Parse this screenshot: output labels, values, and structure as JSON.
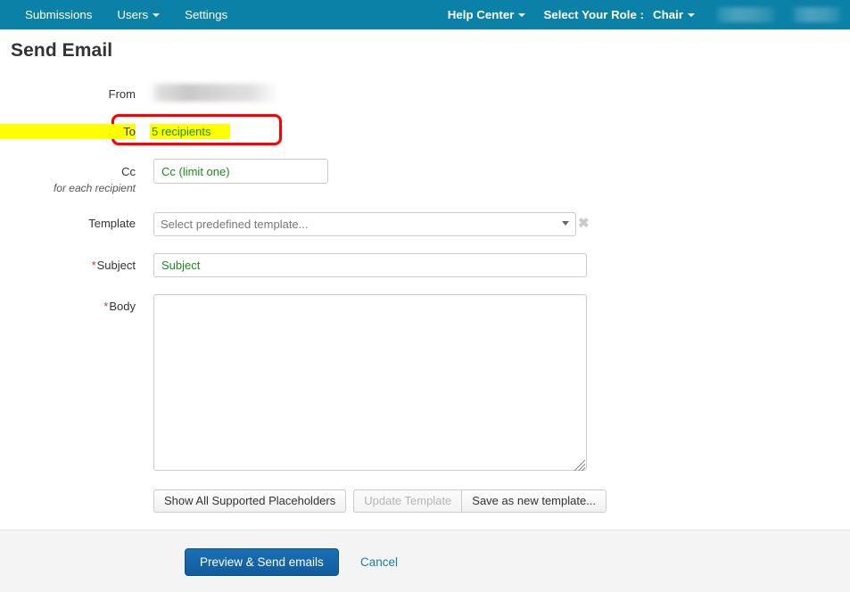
{
  "navbar": {
    "background": "#0b81a7",
    "left_items": [
      {
        "label": "Submissions",
        "has_caret": false
      },
      {
        "label": "Users",
        "has_caret": true
      },
      {
        "label": "Settings",
        "has_caret": false
      }
    ],
    "right_items": [
      {
        "label": "Help Center",
        "has_caret": true
      },
      {
        "label": "Select Your Role :",
        "has_caret": false
      },
      {
        "label": "Chair",
        "has_caret": true
      }
    ],
    "redacted_count": 2
  },
  "page": {
    "title": "Send Email"
  },
  "form": {
    "from": {
      "label": "From",
      "value_redacted": true
    },
    "to": {
      "label": "To",
      "value": "5 recipients",
      "highlight_color": "#ffff00",
      "value_color": "#1d8a1d",
      "annotation_color": "#ff0000"
    },
    "cc": {
      "label": "Cc",
      "sublabel": "for each recipient",
      "value": "",
      "placeholder": "Cc (limit one)",
      "placeholder_color": "#1d8a1d"
    },
    "template": {
      "label": "Template",
      "selected": "Select predefined template...",
      "options": [
        "Select predefined template..."
      ],
      "clear_icon": "✖"
    },
    "subject": {
      "label": "Subject",
      "required_marker": "*",
      "value": "",
      "placeholder": "Subject",
      "placeholder_color": "#1d8a1d"
    },
    "body": {
      "label": "Body",
      "required_marker": "*",
      "value": "",
      "placeholder": ""
    },
    "buttons": {
      "show_placeholders": "Show All Supported Placeholders",
      "update_template": "Update Template",
      "update_template_disabled": true,
      "save_as_new_template": "Save as new template..."
    }
  },
  "footer": {
    "primary_button": "Preview & Send emails",
    "primary_color": "#135f9f",
    "cancel_link": "Cancel",
    "cancel_color": "#1a7fa8"
  }
}
